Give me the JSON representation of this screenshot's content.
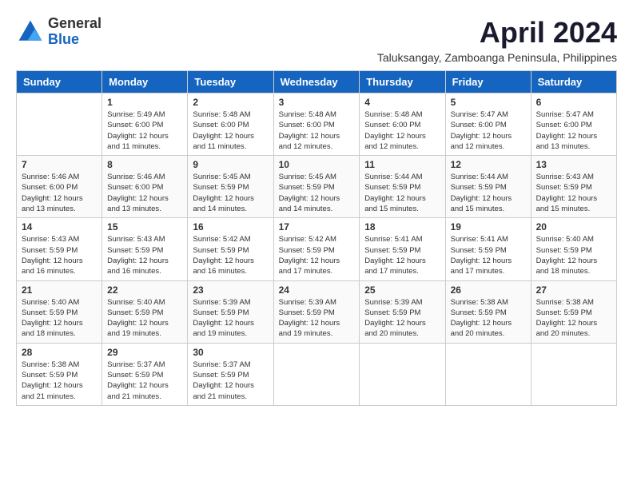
{
  "logo": {
    "general": "General",
    "blue": "Blue"
  },
  "header": {
    "month": "April 2024",
    "location": "Taluksangay, Zamboanga Peninsula, Philippines"
  },
  "weekdays": [
    "Sunday",
    "Monday",
    "Tuesday",
    "Wednesday",
    "Thursday",
    "Friday",
    "Saturday"
  ],
  "weeks": [
    [
      {
        "day": "",
        "info": ""
      },
      {
        "day": "1",
        "info": "Sunrise: 5:49 AM\nSunset: 6:00 PM\nDaylight: 12 hours\nand 11 minutes."
      },
      {
        "day": "2",
        "info": "Sunrise: 5:48 AM\nSunset: 6:00 PM\nDaylight: 12 hours\nand 11 minutes."
      },
      {
        "day": "3",
        "info": "Sunrise: 5:48 AM\nSunset: 6:00 PM\nDaylight: 12 hours\nand 12 minutes."
      },
      {
        "day": "4",
        "info": "Sunrise: 5:48 AM\nSunset: 6:00 PM\nDaylight: 12 hours\nand 12 minutes."
      },
      {
        "day": "5",
        "info": "Sunrise: 5:47 AM\nSunset: 6:00 PM\nDaylight: 12 hours\nand 12 minutes."
      },
      {
        "day": "6",
        "info": "Sunrise: 5:47 AM\nSunset: 6:00 PM\nDaylight: 12 hours\nand 13 minutes."
      }
    ],
    [
      {
        "day": "7",
        "info": ""
      },
      {
        "day": "8",
        "info": "Sunrise: 5:46 AM\nSunset: 6:00 PM\nDaylight: 12 hours\nand 13 minutes."
      },
      {
        "day": "9",
        "info": "Sunrise: 5:45 AM\nSunset: 5:59 PM\nDaylight: 12 hours\nand 14 minutes."
      },
      {
        "day": "10",
        "info": "Sunrise: 5:45 AM\nSunset: 5:59 PM\nDaylight: 12 hours\nand 14 minutes."
      },
      {
        "day": "11",
        "info": "Sunrise: 5:44 AM\nSunset: 5:59 PM\nDaylight: 12 hours\nand 15 minutes."
      },
      {
        "day": "12",
        "info": "Sunrise: 5:44 AM\nSunset: 5:59 PM\nDaylight: 12 hours\nand 15 minutes."
      },
      {
        "day": "13",
        "info": "Sunrise: 5:43 AM\nSunset: 5:59 PM\nDaylight: 12 hours\nand 15 minutes."
      }
    ],
    [
      {
        "day": "14",
        "info": ""
      },
      {
        "day": "15",
        "info": "Sunrise: 5:43 AM\nSunset: 5:59 PM\nDaylight: 12 hours\nand 16 minutes."
      },
      {
        "day": "16",
        "info": "Sunrise: 5:42 AM\nSunset: 5:59 PM\nDaylight: 12 hours\nand 16 minutes."
      },
      {
        "day": "17",
        "info": "Sunrise: 5:42 AM\nSunset: 5:59 PM\nDaylight: 12 hours\nand 17 minutes."
      },
      {
        "day": "18",
        "info": "Sunrise: 5:41 AM\nSunset: 5:59 PM\nDaylight: 12 hours\nand 17 minutes."
      },
      {
        "day": "19",
        "info": "Sunrise: 5:41 AM\nSunset: 5:59 PM\nDaylight: 12 hours\nand 17 minutes."
      },
      {
        "day": "20",
        "info": "Sunrise: 5:40 AM\nSunset: 5:59 PM\nDaylight: 12 hours\nand 18 minutes."
      }
    ],
    [
      {
        "day": "21",
        "info": ""
      },
      {
        "day": "22",
        "info": "Sunrise: 5:40 AM\nSunset: 5:59 PM\nDaylight: 12 hours\nand 19 minutes."
      },
      {
        "day": "23",
        "info": "Sunrise: 5:39 AM\nSunset: 5:59 PM\nDaylight: 12 hours\nand 19 minutes."
      },
      {
        "day": "24",
        "info": "Sunrise: 5:39 AM\nSunset: 5:59 PM\nDaylight: 12 hours\nand 19 minutes."
      },
      {
        "day": "25",
        "info": "Sunrise: 5:39 AM\nSunset: 5:59 PM\nDaylight: 12 hours\nand 20 minutes."
      },
      {
        "day": "26",
        "info": "Sunrise: 5:38 AM\nSunset: 5:59 PM\nDaylight: 12 hours\nand 20 minutes."
      },
      {
        "day": "27",
        "info": "Sunrise: 5:38 AM\nSunset: 5:59 PM\nDaylight: 12 hours\nand 20 minutes."
      }
    ],
    [
      {
        "day": "28",
        "info": "Sunrise: 5:38 AM\nSunset: 5:59 PM\nDaylight: 12 hours\nand 21 minutes."
      },
      {
        "day": "29",
        "info": "Sunrise: 5:37 AM\nSunset: 5:59 PM\nDaylight: 12 hours\nand 21 minutes."
      },
      {
        "day": "30",
        "info": "Sunrise: 5:37 AM\nSunset: 5:59 PM\nDaylight: 12 hours\nand 21 minutes."
      },
      {
        "day": "",
        "info": ""
      },
      {
        "day": "",
        "info": ""
      },
      {
        "day": "",
        "info": ""
      },
      {
        "day": "",
        "info": ""
      }
    ]
  ],
  "week7_sunday": "Sunrise: 5:46 AM\nSunset: 6:00 PM\nDaylight: 12 hours\nand 13 minutes.",
  "week14_sunday": "Sunrise: 5:43 AM\nSunset: 5:59 PM\nDaylight: 12 hours\nand 16 minutes.",
  "week21_sunday": "Sunrise: 5:40 AM\nSunset: 5:59 PM\nDaylight: 12 hours\nand 18 minutes."
}
